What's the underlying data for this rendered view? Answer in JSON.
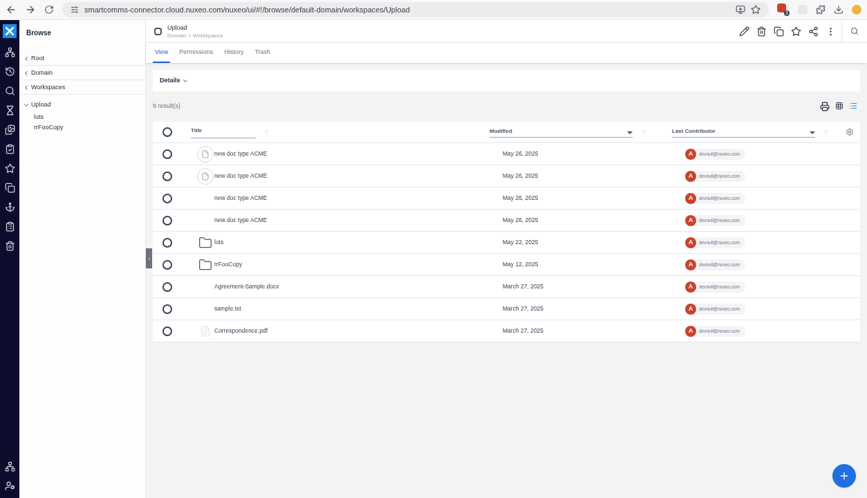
{
  "browser": {
    "url": "smartcomms-connector.cloud.nuxeo.com/nuxeo/ui/#!/browse/default-domain/workspaces/Upload",
    "extension_badge": "3"
  },
  "sidebar": {
    "title": "Browse",
    "ancestors": [
      {
        "label": "Root"
      },
      {
        "label": "Domain"
      },
      {
        "label": "Workspaces"
      }
    ],
    "current": {
      "label": "Upload",
      "expanded": true,
      "children": [
        {
          "label": "lots"
        },
        {
          "label": "rrFooCopy"
        }
      ]
    }
  },
  "header": {
    "title": "Upload",
    "breadcrumb": "Domain > Workspaces"
  },
  "tabs": [
    {
      "label": "View",
      "selected": true
    },
    {
      "label": "Permissions",
      "selected": false
    },
    {
      "label": "History",
      "selected": false
    },
    {
      "label": "Trash",
      "selected": false
    }
  ],
  "details": {
    "label": "Details"
  },
  "results": "9 result(s)",
  "table": {
    "all_selected": false,
    "columns": [
      "Title",
      "Modified",
      "Last Contributor"
    ],
    "rows": [
      {
        "kind": "document",
        "title": "new doc type ACME",
        "modified": "May 26, 2025",
        "initial": "A",
        "contributor": "devnull@nuxeo.com",
        "selected": false
      },
      {
        "kind": "document",
        "title": "new doc type ACME",
        "modified": "May 26, 2025",
        "initial": "A",
        "contributor": "devnull@nuxeo.com",
        "selected": false
      },
      {
        "kind": "blank",
        "title": "new doc type ACME",
        "modified": "May 26, 2025",
        "initial": "A",
        "contributor": "devnull@nuxeo.com",
        "selected": false
      },
      {
        "kind": "blank",
        "title": "new doc type ACME",
        "modified": "May 26, 2025",
        "initial": "A",
        "contributor": "devnull@nuxeo.com",
        "selected": false
      },
      {
        "kind": "folder",
        "title": "lots",
        "modified": "May 22, 2025",
        "initial": "A",
        "contributor": "devnull@nuxeo.com",
        "selected": false
      },
      {
        "kind": "folder",
        "title": "rrFooCopy",
        "modified": "May 12, 2025",
        "initial": "A",
        "contributor": "devnull@nuxeo.com",
        "selected": false
      },
      {
        "kind": "blank",
        "title": "Agreement-Sample.docx",
        "modified": "March 27, 2025",
        "initial": "A",
        "contributor": "devnull@nuxeo.com",
        "selected": false
      },
      {
        "kind": "blank",
        "title": "sample.txt",
        "modified": "March 27, 2025",
        "initial": "A",
        "contributor": "devnull@nuxeo.com",
        "selected": false
      },
      {
        "kind": "faint",
        "title": "Correspondence.pdf",
        "modified": "March 27, 2025",
        "initial": "A",
        "contributor": "devnull@nuxeo.com",
        "selected": false
      }
    ]
  }
}
